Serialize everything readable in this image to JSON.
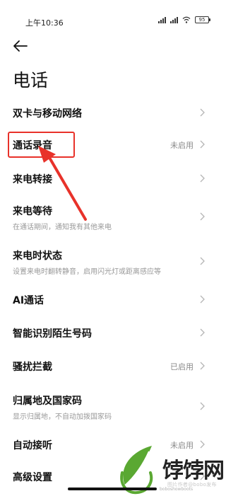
{
  "status_bar": {
    "time": "上午10:36",
    "battery": "95"
  },
  "header": {
    "title": "电话"
  },
  "settings": [
    {
      "title": "双卡与移动网络",
      "subtitle": "",
      "value": ""
    },
    {
      "title": "通话录音",
      "subtitle": "",
      "value": "未启用"
    },
    {
      "title": "来电转接",
      "subtitle": "",
      "value": ""
    },
    {
      "title": "来电等待",
      "subtitle": "在通话期间，通知我有其他来电",
      "value": ""
    },
    {
      "title": "来电时状态",
      "subtitle": "设置来电时翻转静音，启用闪光灯或距离感应等",
      "value": ""
    },
    {
      "title": "AI通话",
      "subtitle": "",
      "value": ""
    },
    {
      "title": "智能识别陌生号码",
      "subtitle": "",
      "value": ""
    },
    {
      "title": "骚扰拦截",
      "subtitle": "",
      "value": "已启用"
    },
    {
      "title": "归属地及国家码",
      "subtitle": "显示归属地，不自动加拨国家码",
      "value": ""
    },
    {
      "title": "自动接听",
      "subtitle": "",
      "value": "未启用"
    },
    {
      "title": "高级设置",
      "subtitle": "",
      "value": ""
    }
  ],
  "watermark": {
    "brand": "饽饽网",
    "line1": "图片作者@bobo发布",
    "line2": "boboshowboots"
  },
  "colors": {
    "highlight": "#e8322a",
    "logo_green": "#5aa832"
  }
}
